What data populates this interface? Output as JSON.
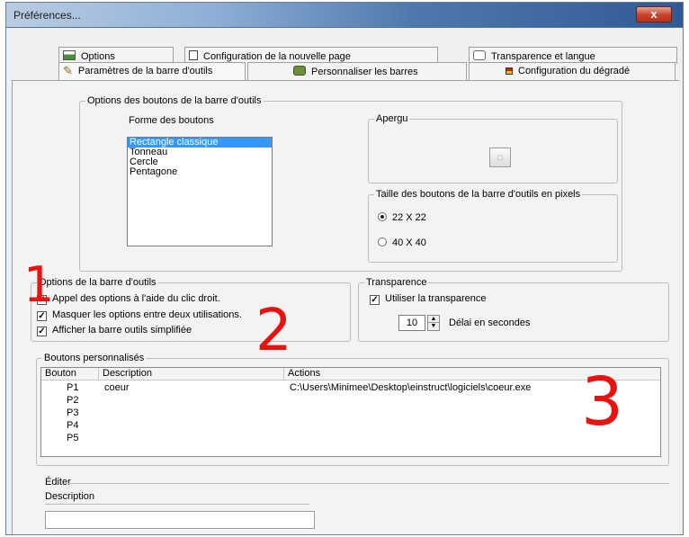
{
  "window": {
    "title": "Préférences...",
    "close": "x"
  },
  "tabs": {
    "back": [
      {
        "label": "Options",
        "icon": "options-icon"
      },
      {
        "label": "Configuration de la nouvelle page",
        "icon": "page-icon"
      },
      {
        "label": "Transparence et langue",
        "icon": "transparency-icon"
      }
    ],
    "front": [
      {
        "label": "Paramètres de la barre d'outils",
        "icon": "tools-icon",
        "active": true
      },
      {
        "label": "Personnaliser les barres",
        "icon": "customize-icon"
      },
      {
        "label": "Configuration du dégradé",
        "icon": "flag-icon"
      }
    ]
  },
  "button_options": {
    "legend": "Options des boutons de la barre d'outils",
    "shape_label": "Forme des boutons",
    "shapes": [
      "Rectangle classique",
      "Tonneau",
      "Cercle",
      "Pentagone"
    ],
    "selected_shape": "Rectangle classique",
    "preview_legend": "Apergu",
    "size_legend": "Taille des boutons de la barre d'outils en pixels",
    "sizes": [
      "22 X 22",
      "40 X 40"
    ],
    "selected_size": "22 X 22"
  },
  "toolbar_options": {
    "legend": "Options de la barre d'outils",
    "checks": [
      {
        "label": "Appel des options à l'aide du clic droit.",
        "checked": true
      },
      {
        "label": "Masquer les options entre deux utilisations.",
        "checked": true
      },
      {
        "label": "Afficher la barre outils simplifiée",
        "checked": true
      }
    ]
  },
  "transparency": {
    "legend": "Transparence",
    "use_label": "Utiliser la transparence",
    "use_checked": true,
    "delay_value": "10",
    "delay_label": "Délai en secondes"
  },
  "custom_buttons": {
    "legend": "Boutons personnalisés",
    "columns": [
      "Bouton",
      "Description",
      "Actions"
    ],
    "rows": [
      {
        "button": "P1",
        "description": "coeur",
        "action": "C:\\Users\\Minimee\\Desktop\\einstruct\\logiciels\\coeur.exe"
      },
      {
        "button": "P2",
        "description": "",
        "action": ""
      },
      {
        "button": "P3",
        "description": "",
        "action": ""
      },
      {
        "button": "P4",
        "description": "",
        "action": ""
      },
      {
        "button": "P5",
        "description": "",
        "action": ""
      }
    ]
  },
  "edit": {
    "legend": "Éditer",
    "description_label": "Description",
    "description_value": ""
  },
  "annotations": [
    "1",
    "2",
    "3"
  ],
  "colors": {
    "annotation": "#e8130f",
    "selection": "#3399ff"
  }
}
